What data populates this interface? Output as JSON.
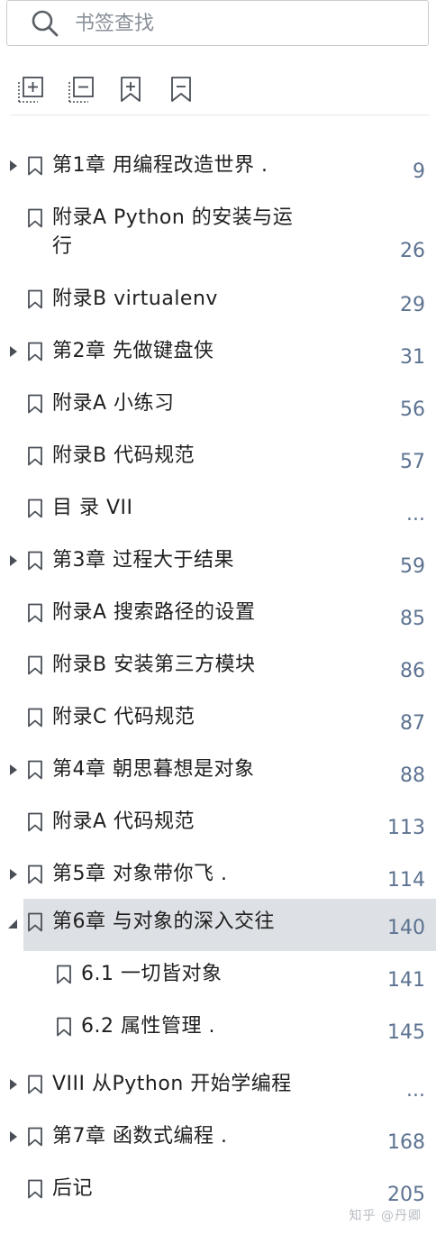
{
  "search": {
    "placeholder": "书签查找"
  },
  "toolbar": {
    "buttons": [
      {
        "name": "expand-all-button"
      },
      {
        "name": "collapse-all-button"
      },
      {
        "name": "add-bookmark-button"
      },
      {
        "name": "remove-bookmark-button"
      }
    ]
  },
  "bookmarks": [
    {
      "title": "第1章 用编程改造世界 .",
      "page": "9",
      "expandable": true,
      "expanded": false,
      "level": 0
    },
    {
      "title": "附录A Python 的安装与运",
      "title2": "行",
      "page": "26",
      "expandable": false,
      "level": 0
    },
    {
      "title": "附录B virtualenv",
      "page": "29",
      "expandable": false,
      "level": 0
    },
    {
      "title": "第2章 先做键盘侠",
      "page": "31",
      "expandable": true,
      "expanded": false,
      "level": 0
    },
    {
      "title": "附录A 小练习",
      "page": "56",
      "expandable": false,
      "level": 0
    },
    {
      "title": "附录B 代码规范",
      "page": "57",
      "expandable": false,
      "level": 0
    },
    {
      "title": "目 录 VII",
      "page": "...",
      "expandable": false,
      "level": 0
    },
    {
      "title": "第3章 过程大于结果",
      "page": "59",
      "expandable": true,
      "expanded": false,
      "level": 0
    },
    {
      "title": "附录A 搜索路径的设置",
      "page": "85",
      "expandable": false,
      "level": 0
    },
    {
      "title": "附录B 安装第三方模块",
      "page": "86",
      "expandable": false,
      "level": 0
    },
    {
      "title": "附录C 代码规范",
      "page": "87",
      "expandable": false,
      "level": 0
    },
    {
      "title": "第4章 朝思暮想是对象",
      "page": "88",
      "expandable": true,
      "expanded": false,
      "level": 0
    },
    {
      "title": "附录A 代码规范",
      "page": "113",
      "expandable": false,
      "level": 0
    },
    {
      "title": "第5章 对象带你飞 .",
      "page": "114",
      "expandable": true,
      "expanded": false,
      "level": 0
    },
    {
      "title": "第6章 与对象的深入交往",
      "page": "140",
      "expandable": true,
      "expanded": true,
      "selected": true,
      "level": 0
    },
    {
      "title": "6.1 一切皆对象",
      "page": "141",
      "expandable": false,
      "level": 1
    },
    {
      "title": "6.2 属性管理 .",
      "page": "145",
      "expandable": false,
      "level": 1
    },
    {
      "title": "VIII 从Python 开始学编程",
      "page": "...",
      "expandable": true,
      "expanded": false,
      "level": 0
    },
    {
      "title": "第7章 函数式编程 .",
      "page": "168",
      "expandable": true,
      "expanded": false,
      "level": 0
    },
    {
      "title": "后记",
      "page": "205",
      "expandable": false,
      "level": 0
    }
  ],
  "watermark": "知乎 @丹卿",
  "colors": {
    "page_number": "#5d7391",
    "selected_row": "#dde0e4",
    "icon_stroke": "#4a4f57"
  }
}
